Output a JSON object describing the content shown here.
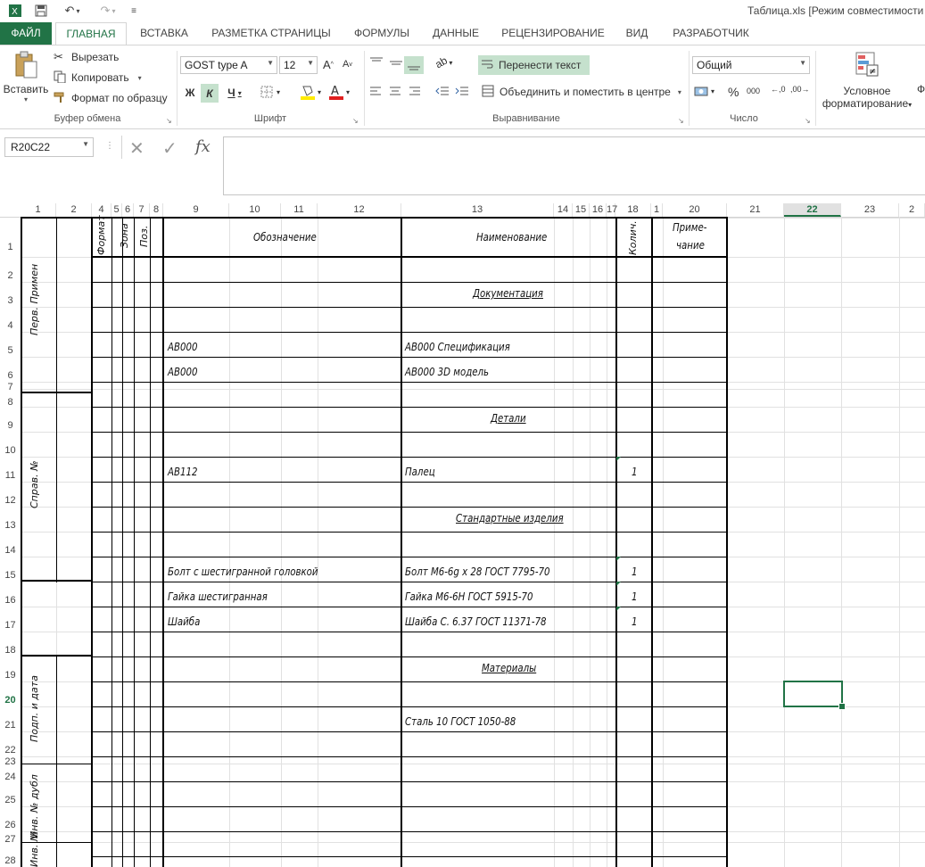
{
  "titlebar": {
    "title": "Таблица.xls  [Режим совместимости"
  },
  "tabs": [
    {
      "label": "ФАЙЛ"
    },
    {
      "label": "ГЛАВНАЯ"
    },
    {
      "label": "ВСТАВКА"
    },
    {
      "label": "РАЗМЕТКА СТРАНИЦЫ"
    },
    {
      "label": "ФОРМУЛЫ"
    },
    {
      "label": "ДАННЫЕ"
    },
    {
      "label": "РЕЦЕНЗИРОВАНИЕ"
    },
    {
      "label": "ВИД"
    },
    {
      "label": "РАЗРАБОТЧИК"
    }
  ],
  "ribbon": {
    "clipboard": {
      "paste": "Вставить",
      "cut": "Вырезать",
      "copy": "Копировать",
      "format_painter": "Формат по образцу",
      "group": "Буфер обмена"
    },
    "font": {
      "family": "GOST type A",
      "size": "12",
      "bold": "Ж",
      "italic": "К",
      "underline": "Ч",
      "group": "Шрифт"
    },
    "alignment": {
      "wrap": "Перенести текст",
      "merge": "Объединить и поместить в центре",
      "group": "Выравнивание"
    },
    "number": {
      "format": "Общий",
      "group": "Число",
      "percent": "%",
      "thousands": "000"
    },
    "styles": {
      "cond_line1": "Условное",
      "cond_line2": "форматирование"
    }
  },
  "formula_bar": {
    "name_box": "R20C22",
    "fx": "fx",
    "value": ""
  },
  "columns": [
    {
      "label": "1"
    },
    {
      "label": "2"
    },
    {
      "label": "4"
    },
    {
      "label": "5"
    },
    {
      "label": "6"
    },
    {
      "label": "7"
    },
    {
      "label": "8"
    },
    {
      "label": "9"
    },
    {
      "label": "10"
    },
    {
      "label": "11"
    },
    {
      "label": "12"
    },
    {
      "label": "13"
    },
    {
      "label": "14"
    },
    {
      "label": "15"
    },
    {
      "label": "16"
    },
    {
      "label": "17"
    },
    {
      "label": "18"
    },
    {
      "label": "1"
    },
    {
      "label": "20"
    },
    {
      "label": "21"
    },
    {
      "label": "22"
    },
    {
      "label": "23"
    },
    {
      "label": "2"
    }
  ],
  "rows": [
    "1",
    "2",
    "3",
    "4",
    "5",
    "6",
    "7",
    "8",
    "9",
    "10",
    "11",
    "12",
    "13",
    "14",
    "15",
    "16",
    "17",
    "18",
    "19",
    "20",
    "21",
    "22",
    "23",
    "24",
    "25",
    "26",
    "27",
    "28"
  ],
  "header": {
    "format": "Формат",
    "zone": "Зона",
    "pos": "Поз.",
    "designation": "Обозначение",
    "name": "Наименование",
    "qty": "Колич.",
    "note1": "Приме-",
    "note2": "чание"
  },
  "side_labels": {
    "perv": "Перв. Примен",
    "sprav": "Справ. №",
    "podp": "Подп. и дата",
    "inv_dubl": "Инв. № дубл",
    "inv": "Инв. №"
  },
  "content": {
    "sec_docs": "Документация",
    "r5_des": "АВ000",
    "r5_name": "АВ000 Спецификация",
    "r6_des": "АВ000",
    "r6_name": "АВ000 3D модель",
    "sec_parts": "Детали",
    "r11_des": "АВ112",
    "r11_name": "Палец",
    "r11_qty": "1",
    "sec_std": "Стандартные изделия",
    "r15_des": "Болт с шестигранной головкой",
    "r15_name": "Болт М6-6g x 28 ГОСТ 7795-70",
    "r15_qty": "1",
    "r16_des": "Гайка шестигранная",
    "r16_name": "Гайка М6-6Н ГОСТ 5915-70",
    "r16_qty": "1",
    "r17_des": "Шайба",
    "r17_name": "Шайба С. 6.37 ГОСТ 11371-78",
    "r17_qty": "1",
    "sec_mat": "Материалы",
    "r21_name": "Сталь 10  ГОСТ 1050-88"
  }
}
